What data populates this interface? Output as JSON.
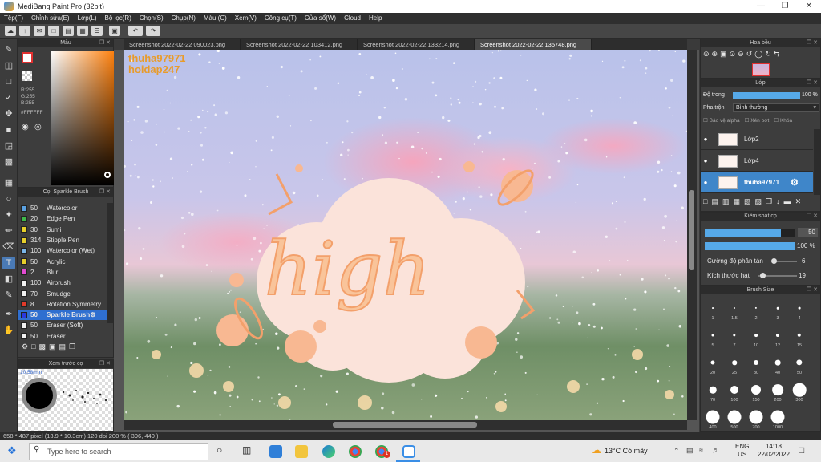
{
  "window": {
    "title": "MediBang Paint Pro (32bit)"
  },
  "menu": [
    "Tệp(F)",
    "Chỉnh sửa(E)",
    "Lớp(L)",
    "Bộ lọc(R)",
    "Chọn(S)",
    "Chụp(N)",
    "Màu (C)",
    "Xem(V)",
    "Công cụ(T)",
    "Cửa sổ(W)",
    "Cloud",
    "Help"
  ],
  "color_panel": {
    "title": "Màu",
    "r": "R:255",
    "g": "G:255",
    "b": "B:255",
    "hex": "#FFFFFF"
  },
  "brush_panel": {
    "title": "Cọ: Sparkle Brush",
    "items": [
      {
        "size": "50",
        "name": "Watercolor",
        "color": "#5aa0e0"
      },
      {
        "size": "20",
        "name": "Edge Pen",
        "color": "#3fb84a"
      },
      {
        "size": "30",
        "name": "Sumi",
        "color": "#e6cf2a"
      },
      {
        "size": "314",
        "name": "Stipple Pen",
        "color": "#e6cf2a"
      },
      {
        "size": "100",
        "name": "Watercolor (Wet)",
        "color": "#7ab7e8"
      },
      {
        "size": "50",
        "name": "Acrylic",
        "color": "#e6cf2a"
      },
      {
        "size": "2",
        "name": "Blur",
        "color": "#e24bd2"
      },
      {
        "size": "100",
        "name": "Airbrush",
        "color": "#f0f0f0"
      },
      {
        "size": "70",
        "name": "Smudge",
        "color": "#f0f0f0"
      },
      {
        "size": "8",
        "name": "Rotation Symmetry",
        "color": "#e23a2a"
      },
      {
        "size": "50",
        "name": "Sparkle Brush",
        "color": "#2a3ae0"
      },
      {
        "size": "50",
        "name": "Eraser (Soft)",
        "color": "#f0f0f0"
      },
      {
        "size": "50",
        "name": "Eraser",
        "color": "#f0f0f0"
      }
    ],
    "selected_index": 10
  },
  "preview_panel": {
    "title": "Xem trước cọ",
    "size_label": "10.58mm"
  },
  "tabs": [
    "Screenshot 2022-02-22 090023.png",
    "Screenshot 2022-02-22 103412.png",
    "Screenshot 2022-02-22 133214.png",
    "Screenshot 2022-02-22 135748.png"
  ],
  "active_tab": 3,
  "canvas": {
    "watermark1": "thuha97971",
    "watermark2": "hoidap247",
    "art_text": "high"
  },
  "navigator": {
    "title": "Hoa bều"
  },
  "layer_panel": {
    "title": "Lớp",
    "opacity_label": "Độ trong",
    "opacity_value": "100 %",
    "opacity": 1.0,
    "blend_label": "Pha trộn",
    "blend_value": "Bình thường",
    "protect_alpha": "Bảo vệ alpha",
    "clipping": "Xén bớt",
    "lock": "Khóa",
    "layers": [
      {
        "name": "Lớp2",
        "active": false
      },
      {
        "name": "Lớp4",
        "active": false
      },
      {
        "name": "thuha97971",
        "active": true
      }
    ]
  },
  "brush_control": {
    "title": "Kiểm soát cọ",
    "size_value": "50",
    "size_fraction": 0.85,
    "opacity_value": "100 %",
    "opacity_fraction": 1.0,
    "scatter_label": "Cường độ phân tán",
    "scatter_value": "6",
    "particle_label": "Kích thước hạt",
    "particle_value": "19"
  },
  "brush_size_panel": {
    "title": "Brush Size",
    "sizes": [
      "1",
      "1.5",
      "2",
      "3",
      "4",
      "5",
      "7",
      "10",
      "12",
      "15",
      "20",
      "25",
      "30",
      "40",
      "50",
      "70",
      "100",
      "150",
      "200",
      "300",
      "400",
      "500",
      "700",
      "1000"
    ]
  },
  "status": {
    "text": "658 * 487 pixel   (13.9 * 10.3cm)   120 dpi   200 %   ( 396, 440 )"
  },
  "taskbar": {
    "search_placeholder": "Type here to search",
    "weather": "13°C  Có mây",
    "lang1": "ENG",
    "lang2": "US",
    "time": "14:18",
    "date": "22/02/2022",
    "notif_count": "1"
  }
}
